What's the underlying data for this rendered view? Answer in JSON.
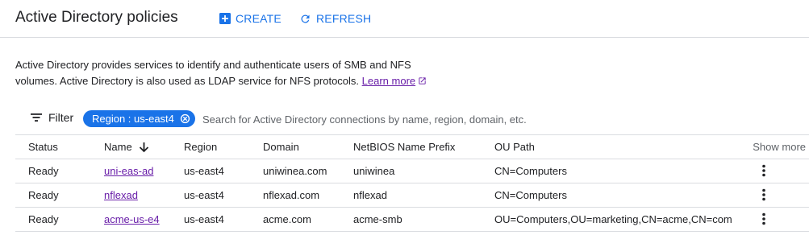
{
  "header": {
    "title": "Active Directory policies",
    "create_label": "CREATE",
    "refresh_label": "REFRESH"
  },
  "description": {
    "text": "Active Directory provides services to identify and authenticate users of SMB and NFS volumes. Active Directory is also used as LDAP service for NFS protocols.",
    "learn_more": "Learn more"
  },
  "filter": {
    "label": "Filter",
    "chip_label": "Region : us-east4",
    "search_placeholder": "Search for Active Directory connections by name, region, domain, etc."
  },
  "table": {
    "columns": {
      "status": "Status",
      "name": "Name",
      "region": "Region",
      "domain": "Domain",
      "netbios": "NetBIOS Name Prefix",
      "ou_path": "OU Path",
      "show_more": "Show more"
    },
    "rows": [
      {
        "status": "Ready",
        "name": "uni-eas-ad",
        "region": "us-east4",
        "domain": "uniwinea.com",
        "netbios": "uniwinea",
        "ou_path": "CN=Computers"
      },
      {
        "status": "Ready",
        "name": "nflexad",
        "region": "us-east4",
        "domain": "nflexad.com",
        "netbios": "nflexad",
        "ou_path": "CN=Computers"
      },
      {
        "status": "Ready",
        "name": "acme-us-e4",
        "region": "us-east4",
        "domain": "acme.com",
        "netbios": "acme-smb",
        "ou_path": "OU=Computers,OU=marketing,CN=acme,CN=com"
      }
    ]
  },
  "icons": {
    "create": "add-box-icon",
    "refresh": "refresh-icon",
    "external": "external-link-icon",
    "filter": "filter-list-icon",
    "chip_close": "cancel-icon",
    "sort": "arrow-down-icon",
    "row_menu": "more-vert-icon"
  },
  "colors": {
    "accent": "#1a73e8",
    "link_visited": "#681da8",
    "divider": "#dadce0"
  }
}
